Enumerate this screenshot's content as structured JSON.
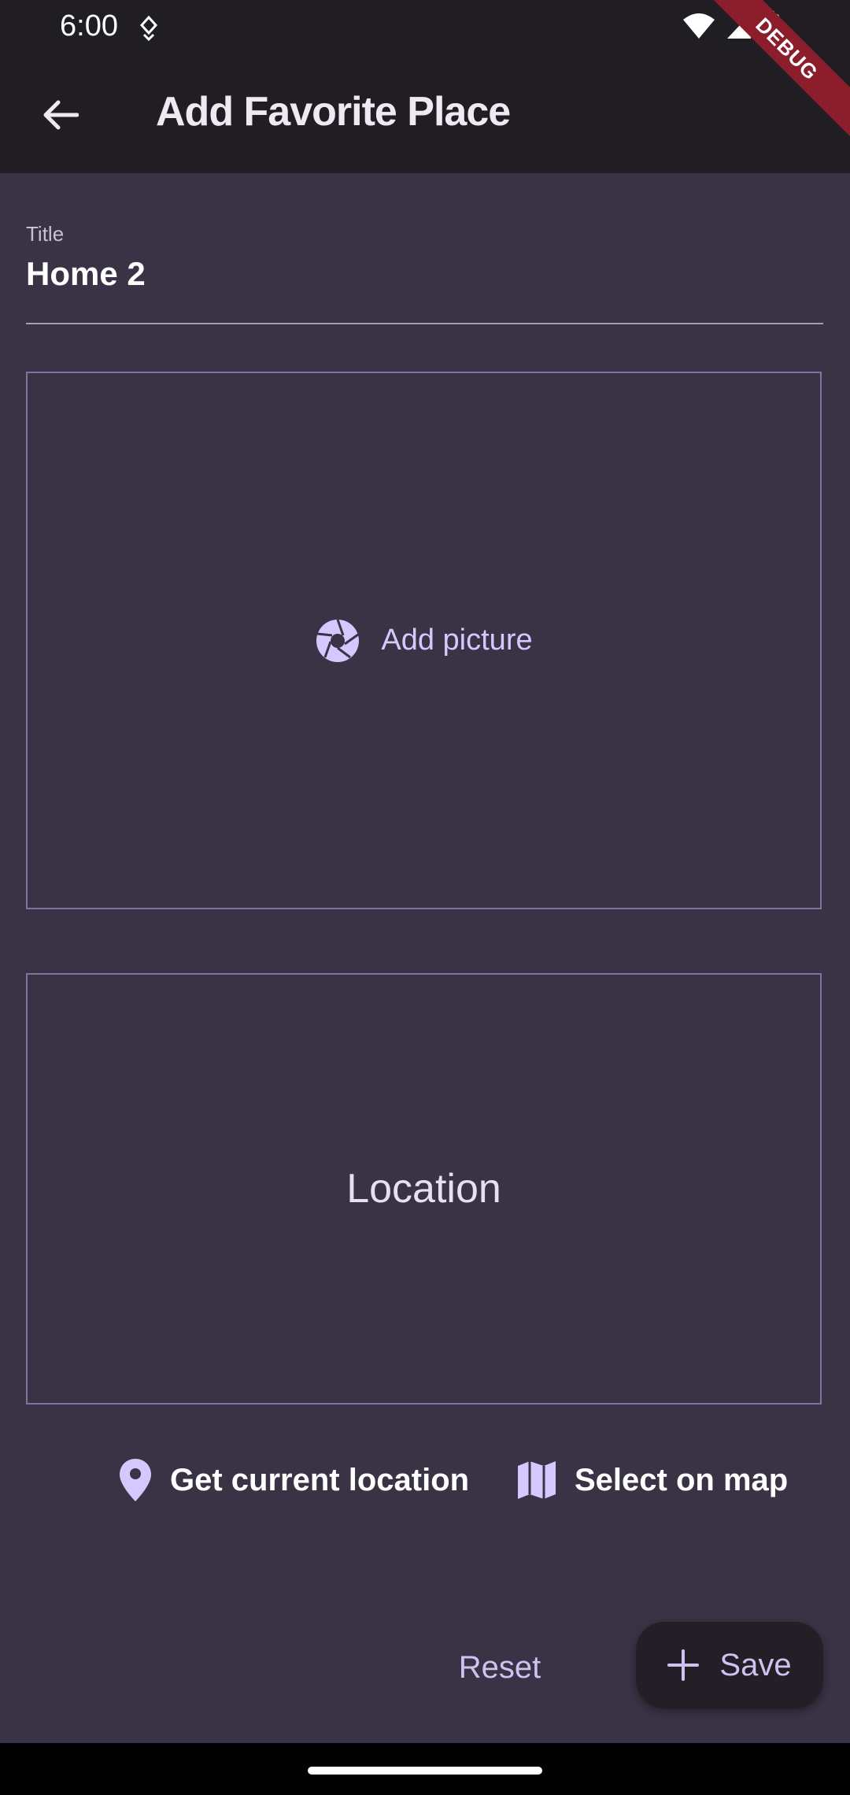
{
  "status": {
    "time": "6:00",
    "icons": [
      "notification-icon",
      "wifi-icon",
      "signal-icon",
      "battery-icon"
    ]
  },
  "app_bar": {
    "title": "Add Favorite Place",
    "back_icon": "arrow-back-icon",
    "debug_banner": "DEBUG"
  },
  "form": {
    "title_label": "Title",
    "title_value": "Home 2"
  },
  "picture": {
    "button_label": "Add picture",
    "icon": "camera-shutter-icon"
  },
  "location": {
    "placeholder": "Location",
    "get_current_label": "Get current location",
    "get_current_icon": "location-pin-icon",
    "select_map_label": "Select on map",
    "select_map_icon": "map-icon"
  },
  "actions": {
    "reset_label": "Reset",
    "save_label": "Save",
    "save_icon": "plus-icon"
  },
  "colors": {
    "background": "#3a3245",
    "app_bar": "#201e22",
    "accent": "#cfc2f0",
    "border": "#7f74a0"
  }
}
